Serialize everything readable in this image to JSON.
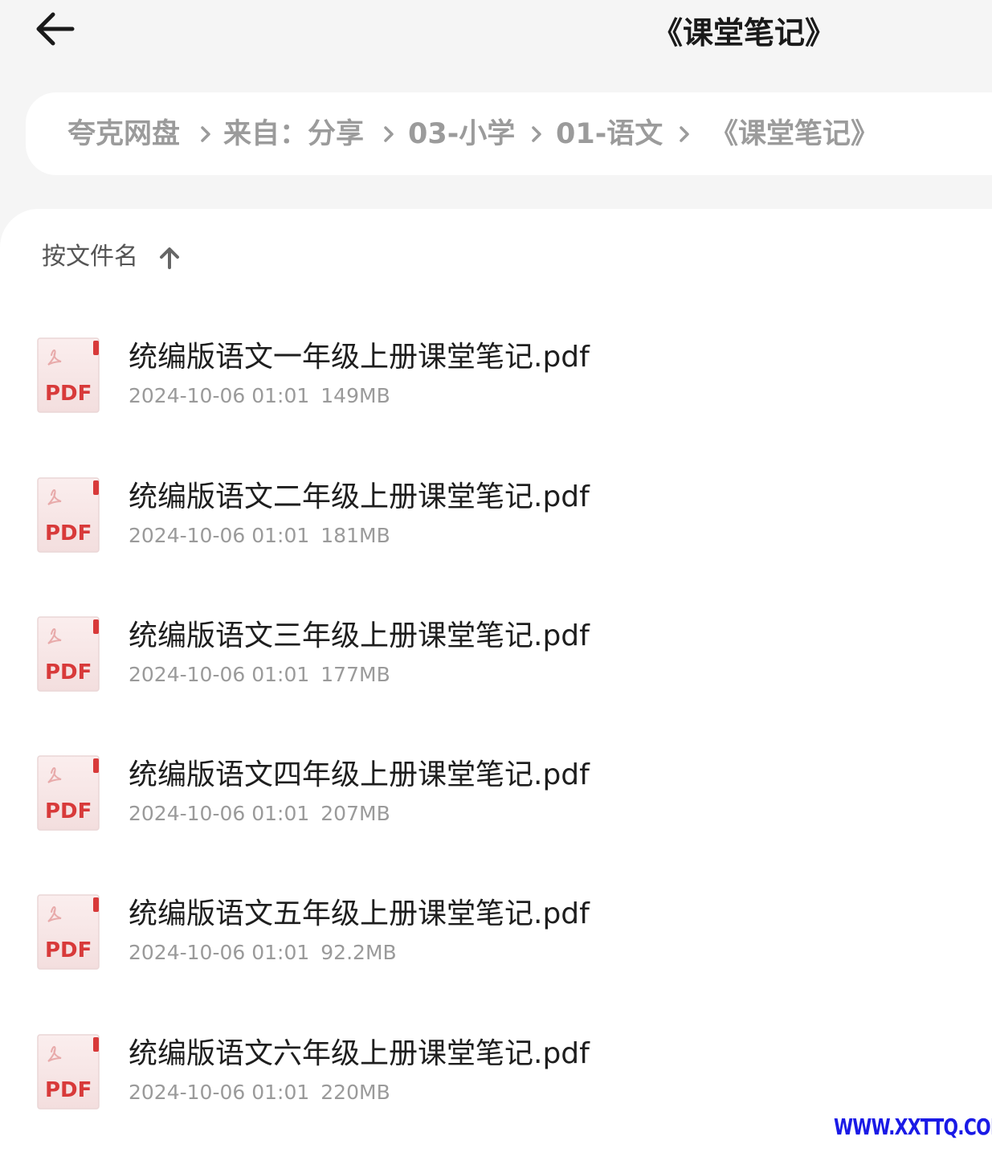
{
  "header": {
    "back_icon": "arrow-left-icon",
    "title": "《课堂笔记》"
  },
  "breadcrumb": {
    "items": [
      "夸克网盘",
      "来自：分享",
      "03-小学",
      "01-语文",
      "《课堂笔记》"
    ],
    "separator_icon": "chevron-right-icon"
  },
  "sort": {
    "label": "按文件名",
    "direction_icon": "arrow-up-icon"
  },
  "files": [
    {
      "name": "统编版语文一年级上册课堂笔记.pdf",
      "date": "2024-10-06 01:01",
      "size": "149MB",
      "icon": "pdf-file-icon",
      "icon_label": "PDF"
    },
    {
      "name": "统编版语文二年级上册课堂笔记.pdf",
      "date": "2024-10-06 01:01",
      "size": "181MB",
      "icon": "pdf-file-icon",
      "icon_label": "PDF"
    },
    {
      "name": "统编版语文三年级上册课堂笔记.pdf",
      "date": "2024-10-06 01:01",
      "size": "177MB",
      "icon": "pdf-file-icon",
      "icon_label": "PDF"
    },
    {
      "name": "统编版语文四年级上册课堂笔记.pdf",
      "date": "2024-10-06 01:01",
      "size": "207MB",
      "icon": "pdf-file-icon",
      "icon_label": "PDF"
    },
    {
      "name": "统编版语文五年级上册课堂笔记.pdf",
      "date": "2024-10-06 01:01",
      "size": "92.2MB",
      "icon": "pdf-file-icon",
      "icon_label": "PDF"
    },
    {
      "name": "统编版语文六年级上册课堂笔记.pdf",
      "date": "2024-10-06 01:01",
      "size": "220MB",
      "icon": "pdf-file-icon",
      "icon_label": "PDF"
    }
  ],
  "watermark": "WWW.XXTTQ.COM",
  "colors": {
    "page_bg": "#f5f5f5",
    "card_bg": "#ffffff",
    "pdf_red": "#d83a3a",
    "watermark_blue": "#1a1ae6"
  }
}
